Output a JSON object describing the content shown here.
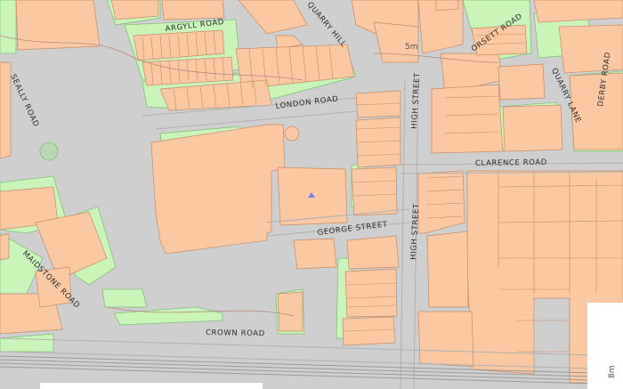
{
  "map": {
    "colors": {
      "road": "#cfcfcf",
      "road_edge": "#b8b8b8",
      "building": "#fbc8a2",
      "building_edge": "#c98a60",
      "green": "#c9f5b8",
      "green_edge": "#7fc07a",
      "rail": "#9a9a9a",
      "white": "#ffffff",
      "contour": "#b58a7a",
      "marker": "#7f7fe0"
    },
    "labels": {
      "argyll_road": "ARGYLL ROAD",
      "quarry_hill": "QUARRY HILL",
      "orsett_road": "ORSETT ROAD",
      "derby_road": "DERBY ROAD",
      "quarry_lane": "QUARRY LANE",
      "high_street_north": "HIGH STREET",
      "london_road": "LONDON ROAD",
      "seally_road": "SEALLY ROAD",
      "clarence_road": "CLARENCE ROAD",
      "george_street": "GEORGE STREET",
      "high_street_south": "HIGH STREET",
      "maidstone_road": "MAIDSTONE ROAD",
      "crown_road": "CROWN ROAD",
      "spot_height_north": "5m",
      "spot_height_east": "8m"
    }
  }
}
